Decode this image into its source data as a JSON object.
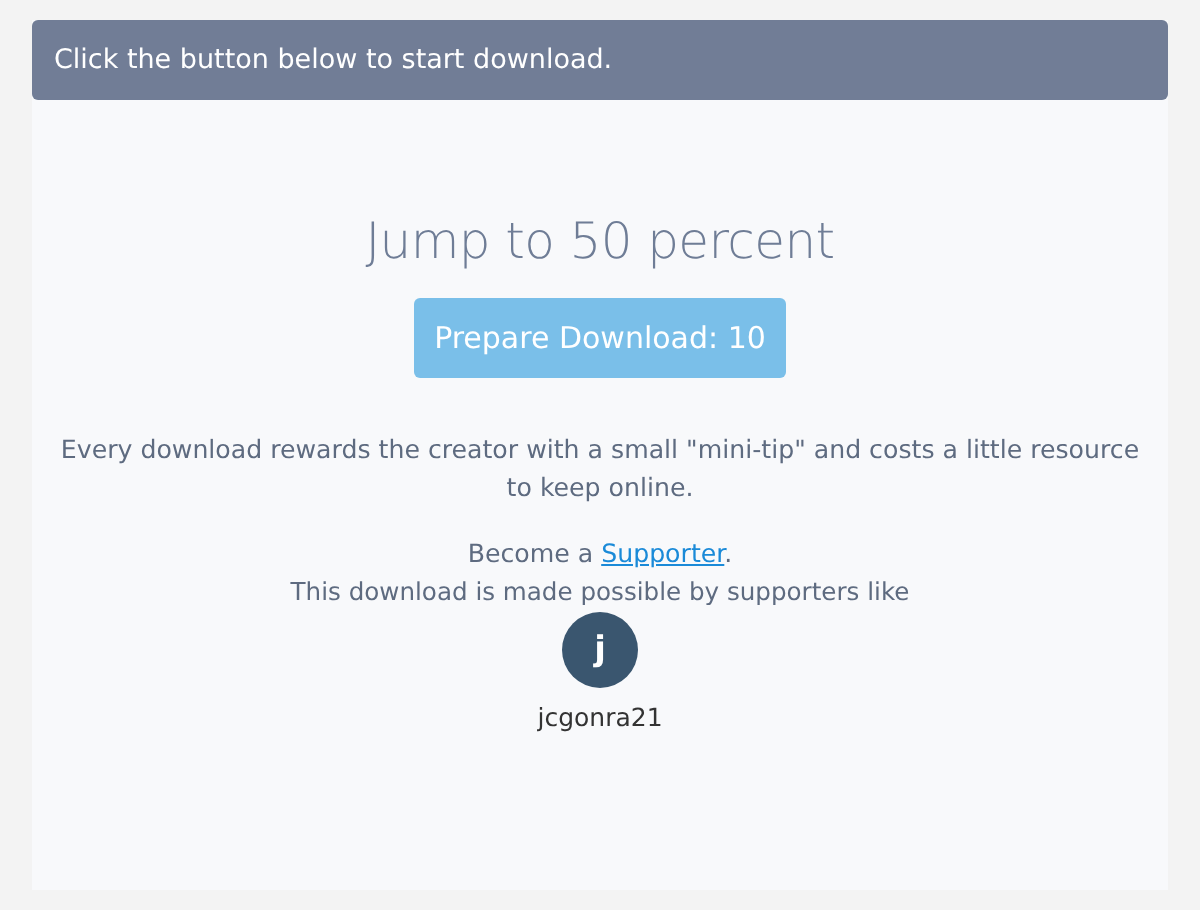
{
  "alert": {
    "text": "Click the button below to start download."
  },
  "title": "Jump to 50 percent",
  "download_button": {
    "label": "Prepare Download: 10",
    "disabled": true
  },
  "description": "Every download rewards the creator with a small \"mini-tip\" and costs a little resource to keep online.",
  "become": {
    "before": "Become a ",
    "link": "Supporter",
    "after": "."
  },
  "supporters_note": "This download is made possible by supporters like",
  "supporters": [
    {
      "initial": "j",
      "name": "jcgonra21"
    }
  ]
}
